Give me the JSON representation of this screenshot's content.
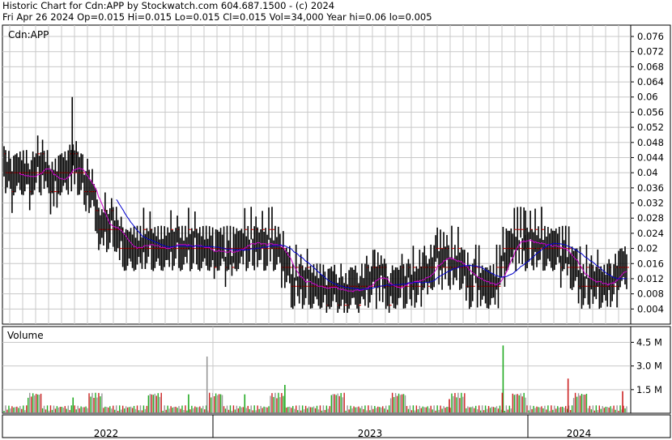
{
  "header": {
    "line1": "Historic Chart for Cdn:APP by Stockwatch.com 604.687.1500 - (c) 2024",
    "line2": "Fri Apr 26 2024   Op=0.015  Hi=0.015  Lo=0.015  Cl=0.015  Vol=34,000  Year hi=0.06  lo=0.005"
  },
  "chart_data": [
    {
      "type": "ohlc",
      "title": "Cdn:APP",
      "symbol_label": "Cdn:APP",
      "ylim": [
        0.0,
        0.079
      ],
      "y_ticks": [
        "0.004",
        "0.008",
        "0.012",
        "0.016",
        "0.02",
        "0.024",
        "0.028",
        "0.032",
        "0.036",
        "0.04",
        "0.044",
        "0.048",
        "0.052",
        "0.056",
        "0.06",
        "0.064",
        "0.068",
        "0.072",
        "0.076"
      ],
      "x_labels": [
        "2022",
        "2023",
        "2024"
      ],
      "grid": true,
      "price_anchors": [
        [
          0,
          0.044
        ],
        [
          8,
          0.038
        ],
        [
          20,
          0.04
        ],
        [
          30,
          0.037
        ],
        [
          40,
          0.042
        ],
        [
          50,
          0.042
        ],
        [
          58,
          0.037
        ],
        [
          66,
          0.038
        ],
        [
          75,
          0.04
        ],
        [
          85,
          0.042
        ],
        [
          92,
          0.04
        ],
        [
          100,
          0.037
        ],
        [
          108,
          0.037
        ],
        [
          114,
          0.03
        ],
        [
          120,
          0.025
        ],
        [
          130,
          0.026
        ],
        [
          140,
          0.025
        ],
        [
          152,
          0.02
        ],
        [
          162,
          0.02
        ],
        [
          170,
          0.021
        ],
        [
          180,
          0.021
        ],
        [
          190,
          0.02
        ],
        [
          200,
          0.02
        ],
        [
          212,
          0.022
        ],
        [
          222,
          0.02
        ],
        [
          230,
          0.02
        ],
        [
          240,
          0.021
        ],
        [
          246,
          0.018
        ],
        [
          254,
          0.02
        ],
        [
          260,
          0.019
        ],
        [
          270,
          0.02
        ],
        [
          282,
          0.018
        ],
        [
          290,
          0.02
        ],
        [
          300,
          0.021
        ],
        [
          312,
          0.022
        ],
        [
          322,
          0.021
        ],
        [
          332,
          0.022
        ],
        [
          342,
          0.02
        ],
        [
          350,
          0.016
        ],
        [
          360,
          0.012
        ],
        [
          372,
          0.012
        ],
        [
          380,
          0.01
        ],
        [
          392,
          0.01
        ],
        [
          400,
          0.01
        ],
        [
          410,
          0.01
        ],
        [
          420,
          0.008
        ],
        [
          432,
          0.01
        ],
        [
          440,
          0.008
        ],
        [
          450,
          0.011
        ],
        [
          462,
          0.012
        ],
        [
          470,
          0.012
        ],
        [
          480,
          0.008
        ],
        [
          492,
          0.01
        ],
        [
          500,
          0.011
        ],
        [
          510,
          0.012
        ],
        [
          520,
          0.012
        ],
        [
          530,
          0.015
        ],
        [
          540,
          0.018
        ],
        [
          552,
          0.018
        ],
        [
          560,
          0.017
        ],
        [
          572,
          0.015
        ],
        [
          580,
          0.012
        ],
        [
          590,
          0.012
        ],
        [
          600,
          0.01
        ],
        [
          612,
          0.011
        ],
        [
          620,
          0.015
        ],
        [
          628,
          0.02
        ],
        [
          640,
          0.022
        ],
        [
          652,
          0.022
        ],
        [
          662,
          0.022
        ],
        [
          672,
          0.021
        ],
        [
          680,
          0.021
        ],
        [
          690,
          0.02
        ],
        [
          700,
          0.018
        ],
        [
          710,
          0.015
        ],
        [
          720,
          0.012
        ],
        [
          730,
          0.012
        ],
        [
          740,
          0.01
        ],
        [
          748,
          0.008
        ],
        [
          752,
          0.012
        ],
        [
          760,
          0.012
        ],
        [
          768,
          0.015
        ],
        [
          776,
          0.015
        ]
      ],
      "volume_ticks": [
        "1.5 M",
        "3.0 M",
        "4.5 M"
      ],
      "volume_label": "Volume",
      "volume_max_m": 5.5,
      "volume_spikes_m": [
        [
          253,
          3.6
        ],
        [
          622,
          4.3
        ],
        [
          703,
          2.2
        ],
        [
          621,
          1.3
        ],
        [
          771,
          1.4
        ],
        [
          350,
          1.8
        ],
        [
          555,
          0.9
        ],
        [
          86,
          1.0
        ],
        [
          230,
          1.2
        ],
        [
          300,
          1.2
        ]
      ],
      "colors": {
        "bar": "#000000",
        "ma_short": "#cc00cc",
        "ma_long": "#0000cc",
        "vol_up": "#22aa22",
        "vol_down": "#cc2222",
        "vol_flat": "#999999",
        "grid": "#c8c8c8",
        "ext": "#cc0000"
      }
    }
  ]
}
